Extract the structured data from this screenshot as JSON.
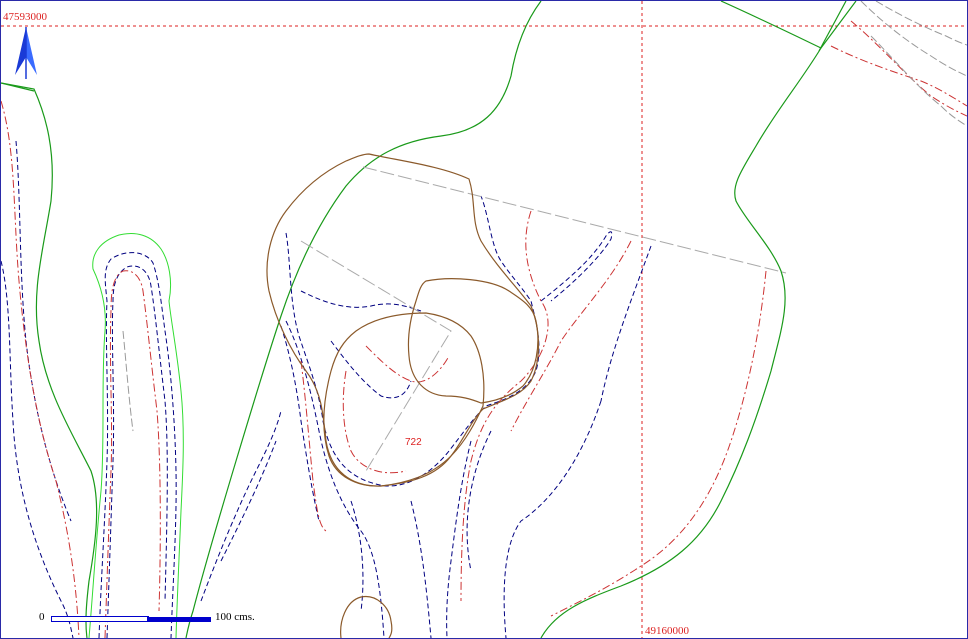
{
  "map": {
    "grid": {
      "northing_label": "47593000",
      "easting_label": "49160000",
      "grid_color": "#dd2222"
    },
    "spot_height": "722",
    "spot_height_color": "#dd2222",
    "scale": {
      "start_label": "0",
      "end_label": "100",
      "unit_label": "cms.",
      "end_text": "100  cms.",
      "color": "#0000cc"
    },
    "north_arrow": {
      "icon": "north-arrow-icon",
      "color": "#1a3ad6"
    },
    "colors": {
      "frame": "#2a2aa8",
      "contour_blue": "#000080",
      "contour_red": "#cc3333",
      "boundary_green": "#1a9a1a",
      "bright_green": "#33dd33",
      "brown_outline": "#8b5a2b",
      "grey_line": "#9a9a9a"
    }
  }
}
